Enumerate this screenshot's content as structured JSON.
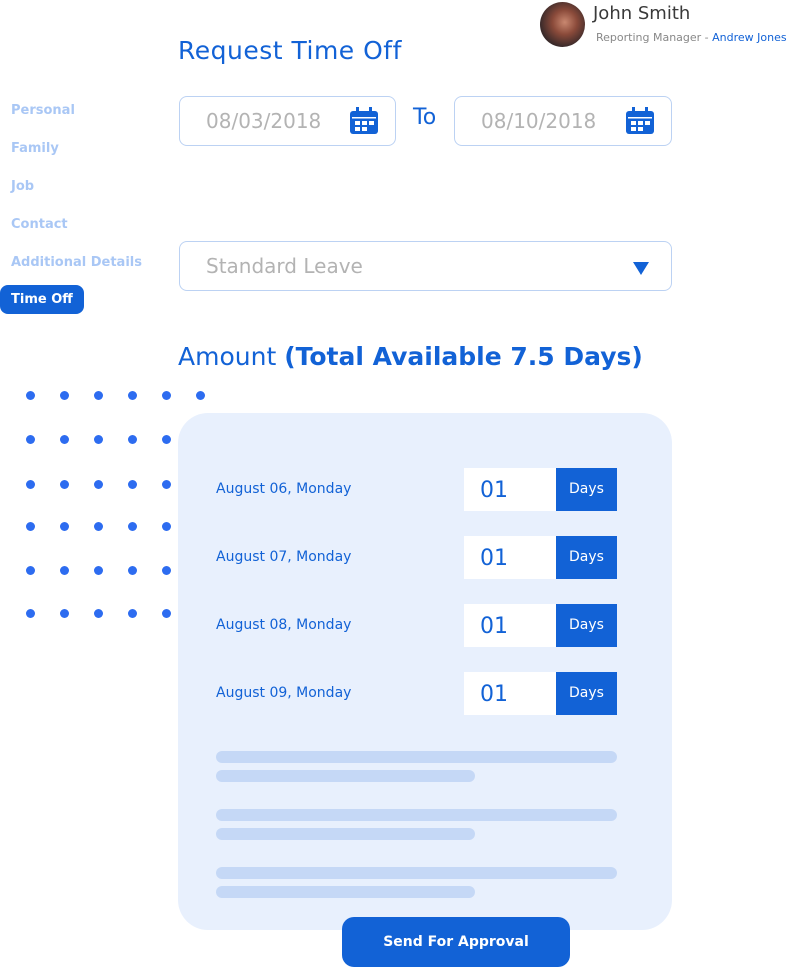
{
  "header": {
    "user_name": "John Smith",
    "role_label": "Reporting Manager - ",
    "manager_name": "Andrew Jones"
  },
  "page_title": "Request Time Off",
  "sidebar": {
    "items": [
      {
        "label": "Personal"
      },
      {
        "label": "Family"
      },
      {
        "label": "Job"
      },
      {
        "label": "Contact"
      },
      {
        "label": "Additional Details"
      },
      {
        "label": "Time Off",
        "active": true
      }
    ]
  },
  "dates": {
    "from": "08/03/2018",
    "to_label": "To",
    "to": "08/10/2018"
  },
  "leave_type": {
    "selected": "Standard Leave"
  },
  "amount": {
    "label": "Amount",
    "available": "(Total Available 7.5 Days)"
  },
  "rows": [
    {
      "date": "August 06, Monday",
      "value": "01",
      "unit": "Days"
    },
    {
      "date": "August 07, Monday",
      "value": "01",
      "unit": "Days"
    },
    {
      "date": "August 08, Monday",
      "value": "01",
      "unit": "Days"
    },
    {
      "date": "August 09, Monday",
      "value": "01",
      "unit": "Days"
    }
  ],
  "submit_label": "Send For Approval",
  "colors": {
    "accent": "#1262d6",
    "card": "#e8f0fd",
    "nav_inactive": "#a9c7f5"
  }
}
